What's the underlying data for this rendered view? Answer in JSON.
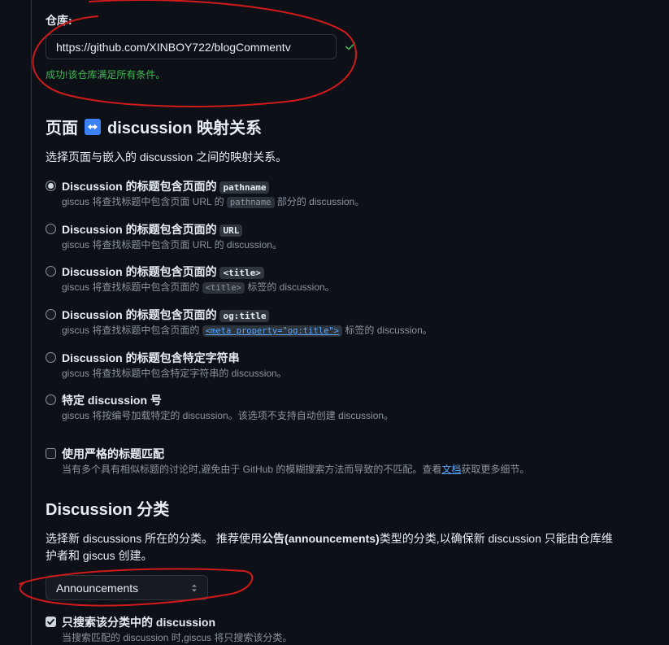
{
  "repository": {
    "label": "仓库:",
    "value": "https://github.com/XINBOY722/blogCommentv",
    "success": "成功!该仓库满足所有条件。"
  },
  "mapping": {
    "title_before": "页面",
    "title_after": "discussion 映射关系",
    "arrow_icon": "left-right-arrow-icon",
    "description": "选择页面与嵌入的 discussion 之间的映射关系。",
    "options": [
      {
        "title": "Discussion 的标题包含页面的",
        "code": "pathname",
        "desc_before": "giscus 将查找标题中包含页面 URL 的",
        "desc_code": "pathname",
        "desc_after": "部分的 discussion。",
        "selected": true
      },
      {
        "title": "Discussion 的标题包含页面的",
        "code": "URL",
        "desc_before": "giscus 将查找标题中包含页面 URL 的 discussion。",
        "selected": false
      },
      {
        "title": "Discussion 的标题包含页面的",
        "code": "<title>",
        "desc_before": "giscus 将查找标题中包含页面的",
        "desc_code": "<title>",
        "desc_after": "标签的 discussion。",
        "selected": false
      },
      {
        "title": "Discussion 的标题包含页面的",
        "code": "og:title",
        "desc_before": "giscus 将查找标题中包含页面的",
        "desc_code": "<meta property=\"og:title\">",
        "desc_after": "标签的 discussion。",
        "selected": false
      },
      {
        "title": "Discussion 的标题包含特定字符串",
        "desc_before": "giscus 将查找标题中包含特定字符串的 discussion。",
        "selected": false
      },
      {
        "title": "特定 discussion 号",
        "desc_before": "giscus 将按编号加载特定的 discussion。该选项不支持自动创建 discussion。",
        "selected": false
      }
    ],
    "strict": {
      "label": "使用严格的标题匹配",
      "desc_before": "当有多个具有相似标题的讨论时,避免由于 GitHub 的模糊搜索方法而导致的不匹配。查看",
      "desc_link": "文档",
      "desc_after": "获取更多细节。",
      "checked": false
    }
  },
  "category": {
    "title": "Discussion 分类",
    "desc_line1_a": "选择新 discussions 所在的分类。 推荐使用",
    "desc_line1_b": "公告(announcements)",
    "desc_line1_c": "类型的分类,以确保新 discussion 只能由仓库维",
    "desc_line2": "护者和 giscus 创建。",
    "selected": "Announcements",
    "filter_label": "只搜索该分类中的 discussion",
    "filter_desc": "当搜索匹配的 discussion 时,giscus 将只搜索该分类。",
    "filter_checked": true
  },
  "colors": {
    "background": "#0d1117",
    "success": "#3fb950",
    "link": "#58a6ff",
    "annotation": "#d11a1a"
  }
}
